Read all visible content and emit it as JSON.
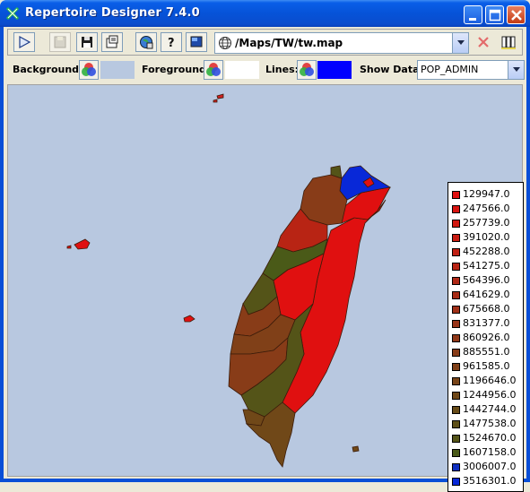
{
  "window": {
    "title": "Repertoire Designer 7.4.0"
  },
  "toolbar": {
    "map_path": "/Maps/TW/tw.map"
  },
  "options": {
    "background_label": "Background:",
    "foreground_label": "Foreground:",
    "lines_label": "Lines:",
    "show_data_label": "Show Data:",
    "show_data_value": "POP_ADMIN",
    "background_color": "#b8c8e0",
    "foreground_color": "#ffffff",
    "lines_color": "#0000ff"
  },
  "legend": {
    "entries": [
      {
        "label": "129947.0",
        "color": "#e01010"
      },
      {
        "label": "247566.0",
        "color": "#d81410"
      },
      {
        "label": "257739.0",
        "color": "#d01810"
      },
      {
        "label": "391020.0",
        "color": "#c81c12"
      },
      {
        "label": "452288.0",
        "color": "#c02014"
      },
      {
        "label": "541275.0",
        "color": "#b82414"
      },
      {
        "label": "564396.0",
        "color": "#b02816"
      },
      {
        "label": "641629.0",
        "color": "#a82c16"
      },
      {
        "label": "675668.0",
        "color": "#a03018"
      },
      {
        "label": "831377.0",
        "color": "#983418"
      },
      {
        "label": "860926.0",
        "color": "#903818"
      },
      {
        "label": "885551.0",
        "color": "#883c18"
      },
      {
        "label": "961585.0",
        "color": "#804018"
      },
      {
        "label": "1196646.0",
        "color": "#784418"
      },
      {
        "label": "1244956.0",
        "color": "#704818"
      },
      {
        "label": "1442744.0",
        "color": "#684c18"
      },
      {
        "label": "1477538.0",
        "color": "#5e5018"
      },
      {
        "label": "1524670.0",
        "color": "#545418"
      },
      {
        "label": "1607158.0",
        "color": "#4a5a18"
      },
      {
        "label": "3006007.0",
        "color": "#1030c0"
      },
      {
        "label": "3516301.0",
        "color": "#0828d8"
      }
    ]
  }
}
